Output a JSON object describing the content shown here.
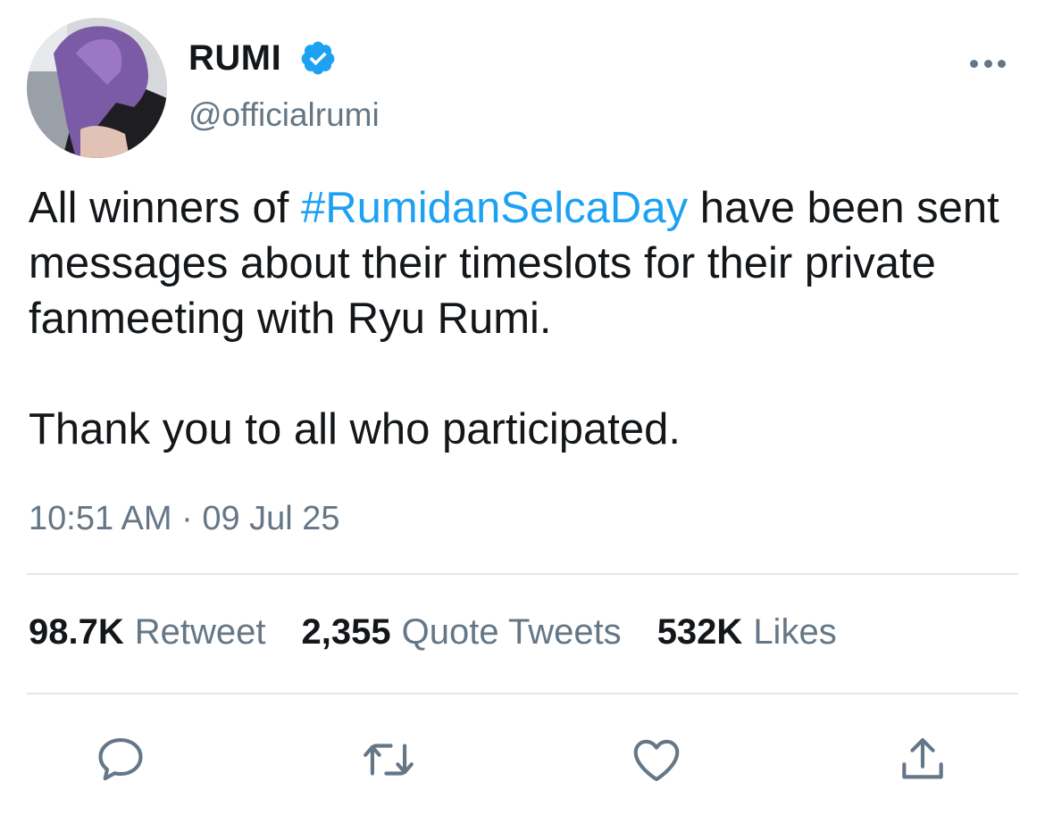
{
  "user": {
    "display_name": "RUMI",
    "handle": "@officialrumi",
    "verified": true
  },
  "tweet": {
    "text_before_hashtag": "All winners of ",
    "hashtag": "#RumidanSelcaDay",
    "text_after_hashtag": " have been sent messages about their timeslots for their private fanmeeting with Ryu Rumi.",
    "second_paragraph": "Thank you to all who participated.",
    "timestamp": "10:51 AM · 09 Jul 25"
  },
  "stats": {
    "retweets": {
      "count": "98.7K",
      "label": "Retweet"
    },
    "quotes": {
      "count": "2,355",
      "label": "Quote Tweets"
    },
    "likes": {
      "count": "532K",
      "label": "Likes"
    }
  },
  "actions": [
    "reply-icon",
    "retweet-icon",
    "like-icon",
    "share-icon"
  ],
  "colors": {
    "link": "#1da1f2",
    "secondary_text": "#657786",
    "divider": "#e1e8ed"
  }
}
